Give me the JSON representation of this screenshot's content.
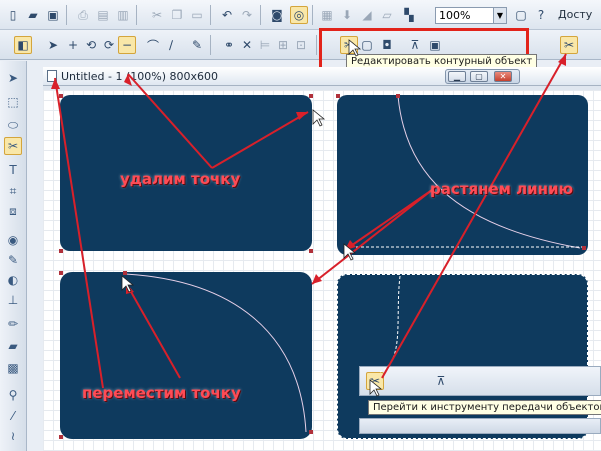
{
  "toolbar": {
    "zoom_value": "100%",
    "trailing_label": "Досту"
  },
  "tooltips": {
    "edit_contour": "Редактировать контурный объект",
    "transfer_tool": "Перейти к инструменту передачи объектов"
  },
  "document": {
    "title": "Untitled - 1 (100%) 800x600"
  },
  "annotations": {
    "delete_point": "удалим точку",
    "stretch_line": "растянем линию",
    "move_point": "переместим точку"
  },
  "colors": {
    "panel": "#0e3a5e",
    "annotation_red": "#ff4b55",
    "highlight_box": "#e2231a"
  }
}
